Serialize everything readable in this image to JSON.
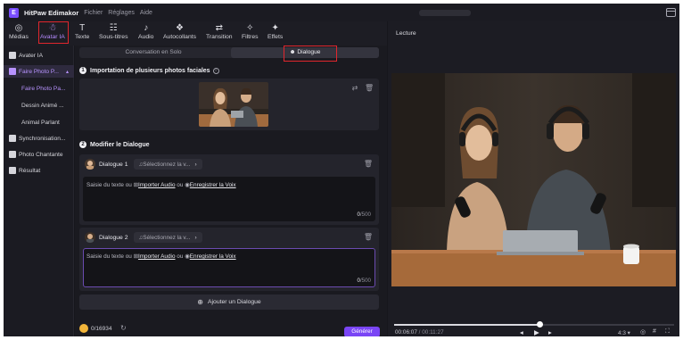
{
  "app": {
    "name": "HitPaw Edimakor",
    "menu": [
      "Fichier",
      "Réglages",
      "Aide"
    ],
    "logo_letter": "E"
  },
  "toolbar": [
    {
      "label": "Médias",
      "icon": "◎",
      "active": false
    },
    {
      "label": "Avatar IA",
      "icon": "☃",
      "active": true
    },
    {
      "label": "Texte",
      "icon": "T",
      "active": false
    },
    {
      "label": "Sous-titres",
      "icon": "☷",
      "active": false
    },
    {
      "label": "Audio",
      "icon": "♪",
      "active": false
    },
    {
      "label": "Autocollants",
      "icon": "❖",
      "active": false
    },
    {
      "label": "Transition",
      "icon": "⇄",
      "active": false
    },
    {
      "label": "Filtres",
      "icon": "✧",
      "active": false
    },
    {
      "label": "Effets",
      "icon": "✦",
      "active": false
    }
  ],
  "sidebar": {
    "items": [
      {
        "label": "Avater IA",
        "icon": "avatar-icon"
      },
      {
        "label": "Faire Photo P...",
        "icon": "photo-icon",
        "selected": true
      },
      {
        "label": "Faire Photo Pa...",
        "sub": true,
        "current": true
      },
      {
        "label": "Dessin Animé ...",
        "sub": true
      },
      {
        "label": "Animal Parlant",
        "sub": true
      },
      {
        "label": "Synchronisation...",
        "icon": "sync-icon"
      },
      {
        "label": "Photo Chantante",
        "icon": "sing-icon"
      },
      {
        "label": "Résultat",
        "icon": "result-icon"
      }
    ],
    "coins": "0/16934"
  },
  "center": {
    "tab_solo": "Conversation en Solo",
    "tab_dialogue": "Dialogue",
    "section1_num": "1",
    "section1_title": "Importation de plusieurs photos faciales",
    "section2_num": "2",
    "section2_title": "Modifier le Dialogue",
    "dialogues": [
      {
        "name": "Dialogue 1",
        "voice_placeholder": "Sélectionnez la v...",
        "text_prompt": "Saisie du texte ou",
        "import_audio": "Importer Audio",
        "or": "ou",
        "record_voice": "Enregistrer la Voix",
        "count": "0",
        "max": "/500"
      },
      {
        "name": "Dialogue 2",
        "voice_placeholder": "Sélectionnez la v...",
        "text_prompt": "Saisie du texte ou",
        "import_audio": "Importer Audio",
        "or": "ou",
        "record_voice": "Enregistrer la Voix",
        "count": "0",
        "max": "/500"
      }
    ],
    "add_dialogue": "Ajouter un Dialogue",
    "generate": "Générer"
  },
  "preview": {
    "title": "Lecture",
    "time_current": "00:06:07",
    "time_total": "/ 00:11:27",
    "progress": 0.52,
    "ratio": "4:3"
  },
  "colors": {
    "accent": "#7a45f5",
    "highlight_box": "#e1262d",
    "active_text": "#b893ff"
  }
}
